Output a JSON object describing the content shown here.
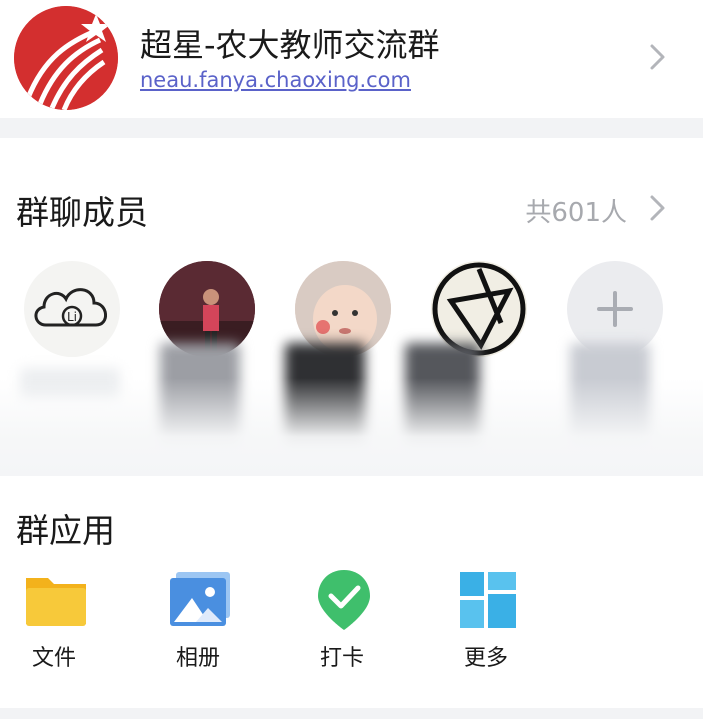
{
  "group": {
    "title": "超星-农大教师交流群",
    "domain": "neau.fanya.chaoxing.com",
    "avatar_icon": "chaoxing-star-logo"
  },
  "members": {
    "title": "群聊成员",
    "count_label": "共601人",
    "add_icon": "plus-icon"
  },
  "apps": {
    "title": "群应用",
    "items": [
      {
        "label": "文件",
        "icon": "folder-icon"
      },
      {
        "label": "相册",
        "icon": "photo-album-icon"
      },
      {
        "label": "打卡",
        "icon": "check-in-icon"
      },
      {
        "label": "更多",
        "icon": "more-grid-icon"
      }
    ]
  },
  "colors": {
    "brand_red": "#d32f2f",
    "link_blue": "#5a62c9",
    "muted_gray": "#a7a9ae",
    "folder_yellow": "#f7c52a",
    "album_blue": "#4a8fe0",
    "checkin_green": "#3fbf6c",
    "more_cyan": "#3ab0e6"
  }
}
